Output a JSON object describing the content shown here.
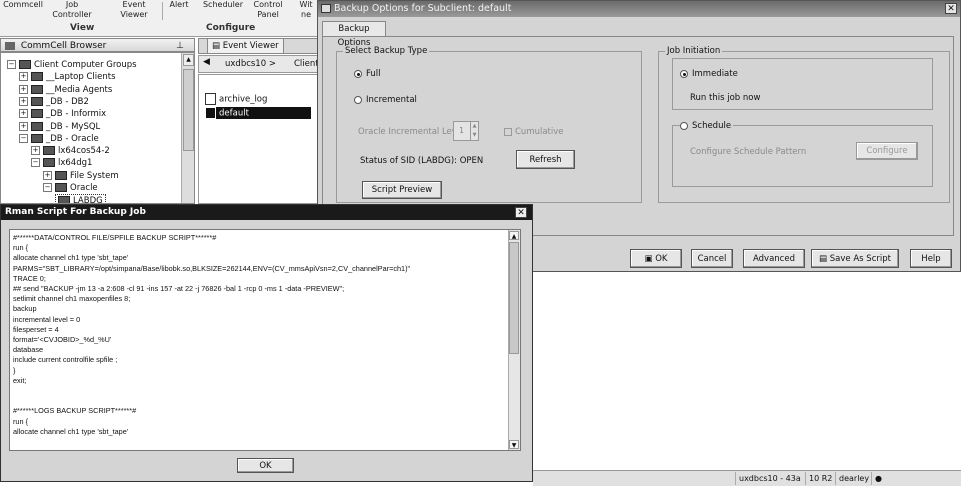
{
  "ribbon": {
    "items": [
      "Commcell",
      "Job\nController",
      "Event\nViewer",
      "Alert",
      "Scheduler",
      "Control\nPanel",
      "Wit\nne"
    ],
    "groups": [
      "View",
      "Configure"
    ]
  },
  "browser": {
    "title": "CommCell Browser",
    "tree": [
      {
        "label": "Client Computer Groups",
        "indent": 0,
        "exp": "−"
      },
      {
        "label": "__Laptop Clients",
        "indent": 1,
        "exp": "+"
      },
      {
        "label": "__Media Agents",
        "indent": 1,
        "exp": "+"
      },
      {
        "label": "_DB - DB2",
        "indent": 1,
        "exp": "+"
      },
      {
        "label": "_DB - Informix",
        "indent": 1,
        "exp": "+"
      },
      {
        "label": "_DB - MySQL",
        "indent": 1,
        "exp": "+"
      },
      {
        "label": "_DB - Oracle",
        "indent": 1,
        "exp": "−"
      },
      {
        "label": "lx64cos54-2",
        "indent": 2,
        "exp": "+"
      },
      {
        "label": "lx64dg1",
        "indent": 2,
        "exp": "−"
      },
      {
        "label": "File System",
        "indent": 3,
        "exp": "+"
      },
      {
        "label": "Oracle",
        "indent": 3,
        "exp": "−"
      },
      {
        "label": "LABDG",
        "indent": 4,
        "exp": ""
      }
    ]
  },
  "event_viewer": {
    "tab": "Event Viewer",
    "breadcrumb": "uxdbcs10 >",
    "crumb2": "Client",
    "items": [
      "archive_log",
      "default"
    ]
  },
  "backup_options": {
    "title": "Backup Options for Subclient: default",
    "tab": "Backup Options",
    "select_type": "Select Backup Type",
    "full": "Full",
    "incremental": "Incremental",
    "incr_level_label": "Oracle Incremental Level",
    "incr_level_value": "1",
    "cumulative": "Cumulative",
    "status": "Status of SID (LABDG): OPEN",
    "refresh": "Refresh",
    "script_preview": "Script Preview",
    "job_init": "Job Initiation",
    "immediate": "Immediate",
    "run_now": "Run this job now",
    "schedule": "Schedule",
    "configure_pattern": "Configure Schedule Pattern",
    "configure": "Configure",
    "buttons": {
      "ok": "OK",
      "cancel": "Cancel",
      "advanced": "Advanced",
      "save_script": "Save As Script",
      "help": "Help"
    }
  },
  "rman": {
    "title": "Rman Script For Backup Job",
    "lines": [
      "#******DATA/CONTROL FILE/SPFILE BACKUP SCRIPT******#",
      "run {",
      "allocate channel ch1 type 'sbt_tape'",
      "PARMS=\"SBT_LIBRARY=/opt/simpana/Base/libobk.so,BLKSIZE=262144,ENV=(CV_mmsApiVsn=2,CV_channelPar=ch1)\"",
      "TRACE 0;",
      "## send \"BACKUP -jm 13 -a 2:608 -cl 91 -ins 157 -at 22 -j 76826 -bal 1 -rcp 0 -ms 1 -data -PREVIEW\";",
      "setlimit channel ch1 maxopenfiles 8;",
      "backup",
      " incremental level = 0",
      " filesperset = 4",
      "format='<CVJOBID>_%d_%U'",
      " database",
      " include current controlfile  spfile  ;",
      "}",
      "exit;",
      "",
      "",
      "#******LOGS BACKUP SCRIPT******#",
      "run {",
      "allocate channel ch1 type 'sbt_tape'"
    ],
    "ok": "OK"
  },
  "statusbar": {
    "server": "uxdbcs10 - 43a",
    "version": "10 R2",
    "user": "dearley"
  }
}
